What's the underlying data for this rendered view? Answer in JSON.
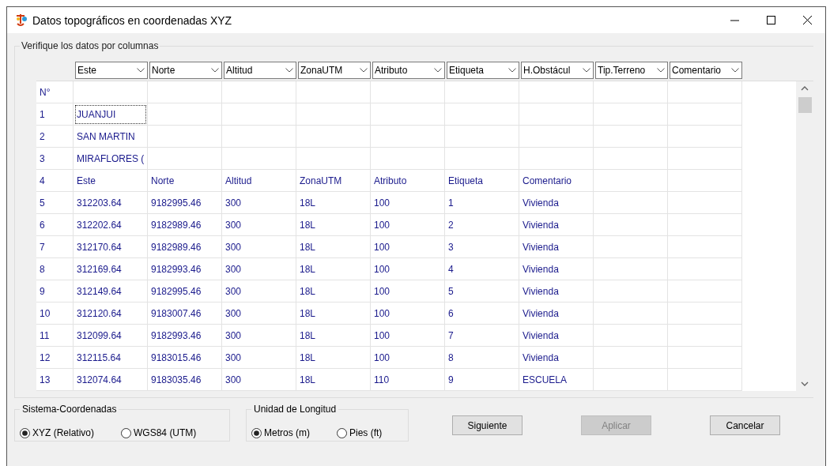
{
  "window": {
    "title": "Datos topográficos en coordenadas XYZ"
  },
  "group": {
    "title": "Verifique los datos por columnas"
  },
  "columns": [
    "Este",
    "Norte",
    "Altitud",
    "ZonaUTM",
    "Atributo",
    "Etiqueta",
    "H.Obstácul",
    "Tip.Terreno",
    "Comentario"
  ],
  "rows": [
    {
      "number": "N°",
      "cells": []
    },
    {
      "number": "1",
      "cells": [
        {
          "text": "JUANJUI",
          "focused": true
        }
      ]
    },
    {
      "number": "2",
      "cells": [
        {
          "text": "SAN MARTIN",
          "focused": false
        }
      ]
    },
    {
      "number": "3",
      "cells": [
        {
          "text": "MIRAFLORES (",
          "focused": false
        }
      ]
    },
    {
      "number": "4",
      "cells": [
        {
          "text": "Este",
          "focused": false
        },
        {
          "text": "Norte",
          "focused": false
        },
        {
          "text": "Altitud",
          "focused": false
        },
        {
          "text": "ZonaUTM",
          "focused": false
        },
        {
          "text": "Atributo",
          "focused": false
        },
        {
          "text": "Etiqueta",
          "focused": false
        },
        {
          "text": "Comentario",
          "focused": false
        }
      ]
    },
    {
      "number": "5",
      "cells": [
        {
          "text": "312203.64",
          "focused": false
        },
        {
          "text": "9182995.46",
          "focused": false
        },
        {
          "text": "300",
          "focused": false
        },
        {
          "text": "18L",
          "focused": false
        },
        {
          "text": "100",
          "focused": false
        },
        {
          "text": "1",
          "focused": false
        },
        {
          "text": "Vivienda",
          "focused": false
        }
      ]
    },
    {
      "number": "6",
      "cells": [
        {
          "text": "312202.64",
          "focused": false
        },
        {
          "text": "9182989.46",
          "focused": false
        },
        {
          "text": "300",
          "focused": false
        },
        {
          "text": "18L",
          "focused": false
        },
        {
          "text": "100",
          "focused": false
        },
        {
          "text": "2",
          "focused": false
        },
        {
          "text": "Vivienda",
          "focused": false
        }
      ]
    },
    {
      "number": "7",
      "cells": [
        {
          "text": "312170.64",
          "focused": false
        },
        {
          "text": "9182989.46",
          "focused": false
        },
        {
          "text": "300",
          "focused": false
        },
        {
          "text": "18L",
          "focused": false
        },
        {
          "text": "100",
          "focused": false
        },
        {
          "text": "3",
          "focused": false
        },
        {
          "text": "Vivienda",
          "focused": false
        }
      ]
    },
    {
      "number": "8",
      "cells": [
        {
          "text": "312169.64",
          "focused": false
        },
        {
          "text": "9182993.46",
          "focused": false
        },
        {
          "text": "300",
          "focused": false
        },
        {
          "text": "18L",
          "focused": false
        },
        {
          "text": "100",
          "focused": false
        },
        {
          "text": "4",
          "focused": false
        },
        {
          "text": "Vivienda",
          "focused": false
        }
      ]
    },
    {
      "number": "9",
      "cells": [
        {
          "text": "312149.64",
          "focused": false
        },
        {
          "text": "9182995.46",
          "focused": false
        },
        {
          "text": "300",
          "focused": false
        },
        {
          "text": "18L",
          "focused": false
        },
        {
          "text": "100",
          "focused": false
        },
        {
          "text": "5",
          "focused": false
        },
        {
          "text": "Vivienda",
          "focused": false
        }
      ]
    },
    {
      "number": "10",
      "cells": [
        {
          "text": "312120.64",
          "focused": false
        },
        {
          "text": "9183007.46",
          "focused": false
        },
        {
          "text": "300",
          "focused": false
        },
        {
          "text": "18L",
          "focused": false
        },
        {
          "text": "100",
          "focused": false
        },
        {
          "text": "6",
          "focused": false
        },
        {
          "text": "Vivienda",
          "focused": false
        }
      ]
    },
    {
      "number": "11",
      "cells": [
        {
          "text": "312099.64",
          "focused": false
        },
        {
          "text": "9182993.46",
          "focused": false
        },
        {
          "text": "300",
          "focused": false
        },
        {
          "text": "18L",
          "focused": false
        },
        {
          "text": "100",
          "focused": false
        },
        {
          "text": "7",
          "focused": false
        },
        {
          "text": "Vivienda",
          "focused": false
        }
      ]
    },
    {
      "number": "12",
      "cells": [
        {
          "text": "312115.64",
          "focused": false
        },
        {
          "text": "9183015.46",
          "focused": false
        },
        {
          "text": "300",
          "focused": false
        },
        {
          "text": "18L",
          "focused": false
        },
        {
          "text": "100",
          "focused": false
        },
        {
          "text": "8",
          "focused": false
        },
        {
          "text": "Vivienda",
          "focused": false
        }
      ]
    },
    {
      "number": "13",
      "cells": [
        {
          "text": "312074.64",
          "focused": false
        },
        {
          "text": "9183035.46",
          "focused": false
        },
        {
          "text": "300",
          "focused": false
        },
        {
          "text": "18L",
          "focused": false
        },
        {
          "text": "110",
          "focused": false
        },
        {
          "text": "9",
          "focused": false
        },
        {
          "text": "ESCUELA",
          "focused": false
        }
      ]
    }
  ],
  "radio_groups": [
    {
      "title": "Sistema-Coordenadas",
      "options": [
        {
          "label": "XYZ (Relativo)",
          "selected": true
        },
        {
          "label": "WGS84 (UTM)",
          "selected": false
        }
      ]
    },
    {
      "title": "Unidad de Longitud",
      "options": [
        {
          "label": "Metros (m)",
          "selected": true
        },
        {
          "label": "Pies (ft)",
          "selected": false
        }
      ]
    }
  ],
  "buttons": [
    {
      "label": "Siguiente",
      "disabled": false
    },
    {
      "label": "Aplicar",
      "disabled": true
    },
    {
      "label": "Cancelar",
      "disabled": false
    }
  ]
}
